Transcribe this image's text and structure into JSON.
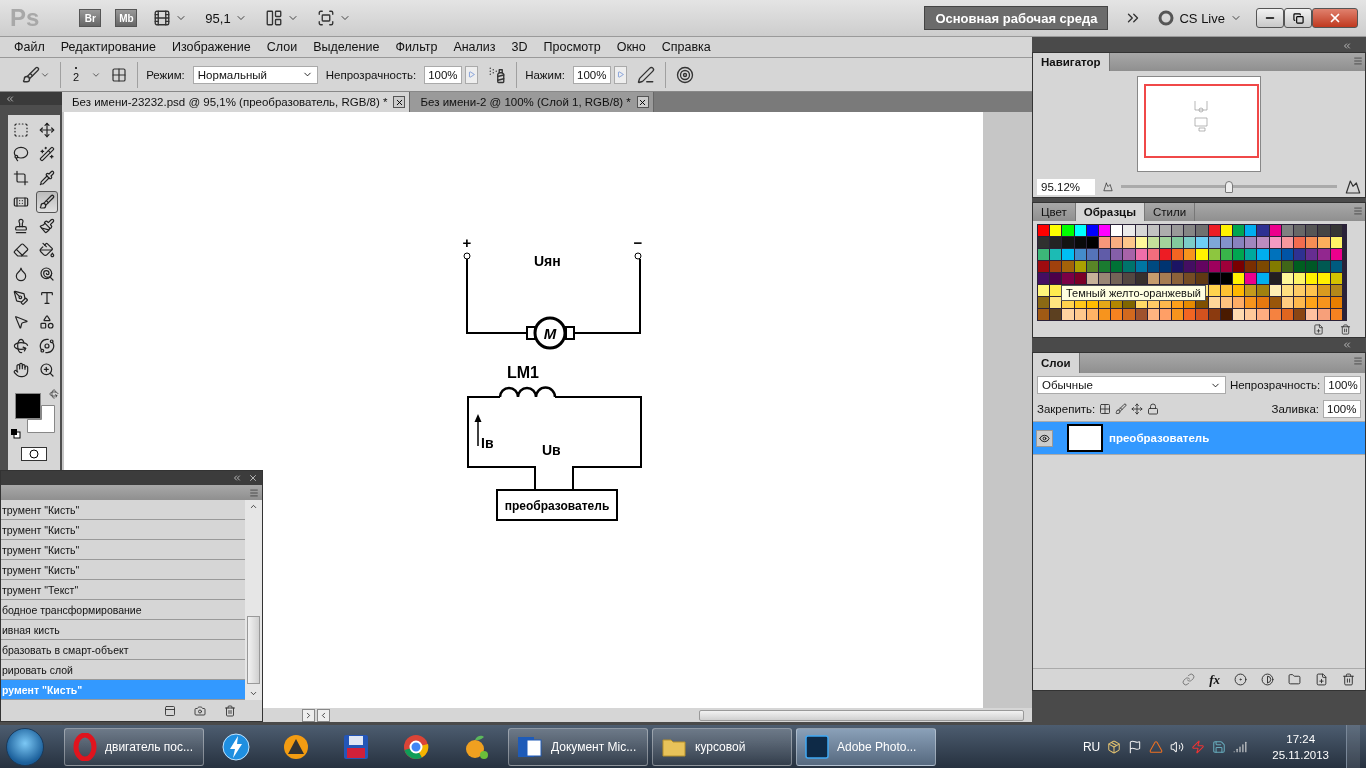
{
  "app_bar": {
    "logo": "Ps",
    "buttons": [
      {
        "label": "Br"
      },
      {
        "label": "Mb"
      }
    ],
    "zoom": "95,1",
    "workspace": "Основная рабочая среда",
    "cs_live": "CS Live"
  },
  "menu": [
    "Файл",
    "Редактирование",
    "Изображение",
    "Слои",
    "Выделение",
    "Фильтр",
    "Анализ",
    "3D",
    "Просмотр",
    "Окно",
    "Справка"
  ],
  "options_bar": {
    "brush_size": "2",
    "mode_label": "Режим:",
    "mode": "Нормальный",
    "opacity_label": "Непрозрачность:",
    "opacity": "100%",
    "pressure_label": "Нажим:",
    "pressure": "100%"
  },
  "documents": [
    {
      "title": "Без имени-23232.psd @ 95,1% (преобразователь, RGB/8) *",
      "selected": true
    },
    {
      "title": "Без имени-2 @ 100% (Слой 1, RGB/8) *",
      "selected": false
    }
  ],
  "tools": [
    {
      "kind": "marquee",
      "selected": false
    },
    {
      "kind": "move",
      "selected": false
    },
    {
      "kind": "lasso",
      "selected": false
    },
    {
      "kind": "wand",
      "selected": false
    },
    {
      "kind": "crop",
      "selected": false
    },
    {
      "kind": "eyedropper",
      "selected": false
    },
    {
      "kind": "heal",
      "selected": false
    },
    {
      "kind": "brush",
      "selected": true
    },
    {
      "kind": "stamp",
      "selected": false
    },
    {
      "kind": "history",
      "selected": false
    },
    {
      "kind": "eraser",
      "selected": false
    },
    {
      "kind": "bucket",
      "selected": false
    },
    {
      "kind": "blur",
      "selected": false
    },
    {
      "kind": "dodge",
      "selected": false
    },
    {
      "kind": "pen",
      "selected": false
    },
    {
      "kind": "type",
      "selected": false
    },
    {
      "kind": "select",
      "selected": false
    },
    {
      "kind": "shape",
      "selected": false
    },
    {
      "kind": "rotate",
      "selected": false
    },
    {
      "kind": "orbit",
      "selected": false
    },
    {
      "kind": "hand",
      "selected": false
    },
    {
      "kind": "zoom",
      "selected": false
    }
  ],
  "foreground": {
    "color": "#000000"
  },
  "background": {
    "color": "#ffffff"
  },
  "canvas": {
    "plus": "+",
    "minus": "−",
    "armature_voltage": "Uян",
    "motor": "M",
    "winding": "LM1",
    "field_current": "Iв",
    "field_voltage": "Uв",
    "converter": "преобразователь"
  },
  "history": {
    "items": [
      {
        "text": "трумент \"Кисть\"",
        "selected": false
      },
      {
        "text": "трумент \"Кисть\"",
        "selected": false
      },
      {
        "text": "трумент \"Кисть\"",
        "selected": false
      },
      {
        "text": "трумент \"Кисть\"",
        "selected": false
      },
      {
        "text": "трумент \"Текст\"",
        "selected": false
      },
      {
        "text": "бодное трансформирование",
        "selected": false
      },
      {
        "text": "ивная кисть",
        "selected": false
      },
      {
        "text": "бразовать в смарт-объект",
        "selected": false
      },
      {
        "text": "рировать слой",
        "selected": false
      },
      {
        "text": "румент \"Кисть\"",
        "selected": true
      }
    ]
  },
  "navigator": {
    "tab": "Навигатор",
    "zoom": "95.12%",
    "level": 0.5
  },
  "swatches_panel": {
    "tabs": [
      {
        "label": "Цвет",
        "selected": false
      },
      {
        "label": "Образцы",
        "selected": true
      },
      {
        "label": "Стили",
        "selected": false
      }
    ],
    "rows": [
      [
        {
          "color": "#ff0000"
        },
        {
          "color": "#ffff00"
        },
        {
          "color": "#00ff00"
        },
        {
          "color": "#00ffff"
        },
        {
          "color": "#0000ff"
        },
        {
          "color": "#ff00ff"
        },
        {
          "color": "#ffffff"
        },
        {
          "color": "#ebebeb"
        },
        {
          "color": "#d6d6d6"
        },
        {
          "color": "#c2c2c2"
        },
        {
          "color": "#adadad"
        },
        {
          "color": "#999999"
        },
        {
          "color": "#858585"
        },
        {
          "color": "#707070"
        },
        {
          "color": "#ed1c24"
        },
        {
          "color": "#fff200"
        },
        {
          "color": "#00a651"
        },
        {
          "color": "#00aeef"
        },
        {
          "color": "#2e3192"
        },
        {
          "color": "#ec008c"
        },
        {
          "color": "#808080"
        },
        {
          "color": "#676767"
        },
        {
          "color": "#555555"
        },
        {
          "color": "#444444"
        },
        {
          "color": "#363636"
        }
      ],
      [
        {
          "color": "#303030"
        },
        {
          "color": "#242424"
        },
        {
          "color": "#141414"
        },
        {
          "color": "#0a0a0a"
        },
        {
          "color": "#000000"
        },
        {
          "color": "#f7977a"
        },
        {
          "color": "#f9ad81"
        },
        {
          "color": "#fdc68a"
        },
        {
          "color": "#fff79a"
        },
        {
          "color": "#c4df9b"
        },
        {
          "color": "#a3d39c"
        },
        {
          "color": "#82ca9d"
        },
        {
          "color": "#7bcdc8"
        },
        {
          "color": "#6ecff6"
        },
        {
          "color": "#7ea7d8"
        },
        {
          "color": "#8493ca"
        },
        {
          "color": "#8882be"
        },
        {
          "color": "#a187be"
        },
        {
          "color": "#bc8dbf"
        },
        {
          "color": "#f49ac2"
        },
        {
          "color": "#f6989d"
        },
        {
          "color": "#f26c4f"
        },
        {
          "color": "#f68e55"
        },
        {
          "color": "#fbaf5c"
        },
        {
          "color": "#fff467"
        }
      ],
      [
        {
          "color": "#3cb878"
        },
        {
          "color": "#1cbbb4"
        },
        {
          "color": "#00bff3"
        },
        {
          "color": "#448ccb"
        },
        {
          "color": "#5574b9"
        },
        {
          "color": "#605ca8"
        },
        {
          "color": "#855fa8"
        },
        {
          "color": "#a763a8"
        },
        {
          "color": "#f06ea9"
        },
        {
          "color": "#f26d7d"
        },
        {
          "color": "#ed1c24"
        },
        {
          "color": "#f26522"
        },
        {
          "color": "#f7941d"
        },
        {
          "color": "#fff200"
        },
        {
          "color": "#8dc63f"
        },
        {
          "color": "#39b54a"
        },
        {
          "color": "#00a651"
        },
        {
          "color": "#00a99d"
        },
        {
          "color": "#00aeef"
        },
        {
          "color": "#0072bc"
        },
        {
          "color": "#0054a6"
        },
        {
          "color": "#2e3192"
        },
        {
          "color": "#662d91"
        },
        {
          "color": "#92278f"
        },
        {
          "color": "#ec008c"
        }
      ],
      [
        {
          "color": "#9e0b0f"
        },
        {
          "color": "#a0410d"
        },
        {
          "color": "#a36209"
        },
        {
          "color": "#aba000"
        },
        {
          "color": "#598527"
        },
        {
          "color": "#1a7b30"
        },
        {
          "color": "#007236"
        },
        {
          "color": "#00746b"
        },
        {
          "color": "#0076a3"
        },
        {
          "color": "#004a80"
        },
        {
          "color": "#003471"
        },
        {
          "color": "#1b1464"
        },
        {
          "color": "#440e62"
        },
        {
          "color": "#630460"
        },
        {
          "color": "#9e005d"
        },
        {
          "color": "#9e0039"
        },
        {
          "color": "#790000"
        },
        {
          "color": "#7b2e00"
        },
        {
          "color": "#7d4900"
        },
        {
          "color": "#827b00"
        },
        {
          "color": "#406618"
        },
        {
          "color": "#005e20"
        },
        {
          "color": "#005826"
        },
        {
          "color": "#005952"
        },
        {
          "color": "#005b7f"
        }
      ],
      [
        {
          "color": "#440e62"
        },
        {
          "color": "#4b0049"
        },
        {
          "color": "#7b0046"
        },
        {
          "color": "#7a0026"
        },
        {
          "color": "#c7b299"
        },
        {
          "color": "#998675"
        },
        {
          "color": "#736357"
        },
        {
          "color": "#534741"
        },
        {
          "color": "#37302d"
        },
        {
          "color": "#c69c6d"
        },
        {
          "color": "#a67c52"
        },
        {
          "color": "#8c6239"
        },
        {
          "color": "#754c24"
        },
        {
          "color": "#603913"
        },
        {
          "color": "#000000"
        },
        {
          "color": "#000000"
        },
        {
          "color": "#fff200"
        },
        {
          "color": "#ec008c"
        },
        {
          "color": "#00aeef"
        },
        {
          "color": "#231f20"
        },
        {
          "color": "#fff799"
        },
        {
          "color": "#fff568"
        },
        {
          "color": "#fff200"
        },
        {
          "color": "#ffef00"
        },
        {
          "color": "#d4c200"
        }
      ],
      [
        {
          "color": "#fff57a"
        },
        {
          "color": "#ffec4f"
        },
        null,
        null,
        null,
        null,
        null,
        null,
        null,
        null,
        null,
        null,
        null,
        {
          "color": "#ffe680"
        },
        {
          "color": "#ffd24d"
        },
        {
          "color": "#ffc233"
        },
        {
          "color": "#ffb800"
        },
        {
          "color": "#c49a1c"
        },
        {
          "color": "#a0800f"
        },
        {
          "color": "#ffeeb3"
        },
        {
          "color": "#ffdf80"
        },
        {
          "color": "#ffcc66"
        },
        {
          "color": "#ffc34d"
        },
        {
          "color": "#d99b1f"
        },
        {
          "color": "#b3871a"
        }
      ],
      [
        {
          "color": "#8b6914"
        },
        {
          "color": "#ffe680"
        },
        {
          "color": "#ffd24d"
        },
        {
          "color": "#ffc61a"
        },
        {
          "color": "#ffbb00"
        },
        {
          "color": "#e6a817"
        },
        {
          "color": "#b38600"
        },
        {
          "color": "#806600"
        },
        {
          "color": "#ffd966"
        },
        {
          "color": "#ffc966"
        },
        {
          "color": "#ffb84d"
        },
        {
          "color": "#ff9f1a"
        },
        {
          "color": "#e68a00"
        },
        {
          "color": "#805000"
        },
        {
          "color": "#ffd699"
        },
        {
          "color": "#ffc27f"
        },
        {
          "color": "#ffad66"
        },
        {
          "color": "#f7941d"
        },
        {
          "color": "#e6780f"
        },
        {
          "color": "#99560a"
        },
        {
          "color": "#ffcc80"
        },
        {
          "color": "#ffb84d"
        },
        {
          "color": "#ffa31a"
        },
        {
          "color": "#f7941d"
        },
        {
          "color": "#e67e00"
        }
      ],
      [
        {
          "color": "#a05a14"
        },
        {
          "color": "#5c4020"
        },
        {
          "color": "#ffd2a0"
        },
        {
          "color": "#ffc88c"
        },
        {
          "color": "#ffb366"
        },
        {
          "color": "#f7941d"
        },
        {
          "color": "#f58220"
        },
        {
          "color": "#d2691e"
        },
        {
          "color": "#a0522d"
        },
        {
          "color": "#ffb380"
        },
        {
          "color": "#ff9f66"
        },
        {
          "color": "#f7941d"
        },
        {
          "color": "#f26522"
        },
        {
          "color": "#d2521e"
        },
        {
          "color": "#8b3a0f"
        },
        {
          "color": "#4a1a00"
        },
        {
          "color": "#ffdab0"
        },
        {
          "color": "#ffc99a"
        },
        {
          "color": "#ffad80"
        },
        {
          "color": "#f58240"
        },
        {
          "color": "#e0651f"
        },
        {
          "color": "#8b4513"
        },
        {
          "color": "#ffc0a0"
        },
        {
          "color": "#f7a07a"
        },
        {
          "color": "#f58220"
        }
      ]
    ],
    "tooltip": "Темный желто-оранжевый"
  },
  "layers_panel": {
    "tab": "Слои",
    "blend_mode": "Обычные",
    "opacity_label": "Непрозрачность:",
    "opacity": "100%",
    "lock_label": "Закрепить:",
    "fill_label": "Заливка:",
    "fill": "100%",
    "fx_label": "fx",
    "layers": [
      {
        "name": "преобразователь",
        "visible": true,
        "selected": true
      }
    ]
  },
  "taskbar": {
    "items": [
      {
        "kind": "opera",
        "label": "двигатель пос...",
        "selected": false
      },
      {
        "kind": "flash",
        "selected": false
      },
      {
        "kind": "aimp",
        "selected": false
      },
      {
        "kind": "floppy",
        "selected": false
      },
      {
        "kind": "chrome",
        "selected": false
      },
      {
        "kind": "fruit",
        "selected": false
      },
      {
        "kind": "word",
        "label": "Документ Mic...",
        "selected": false
      },
      {
        "kind": "folder",
        "label": "курсовой",
        "selected": false
      },
      {
        "kind": "photoshop",
        "label": "Adobe Photo...",
        "selected": true
      }
    ],
    "language": "RU",
    "time": "17:24",
    "date": "25.11.2013"
  }
}
